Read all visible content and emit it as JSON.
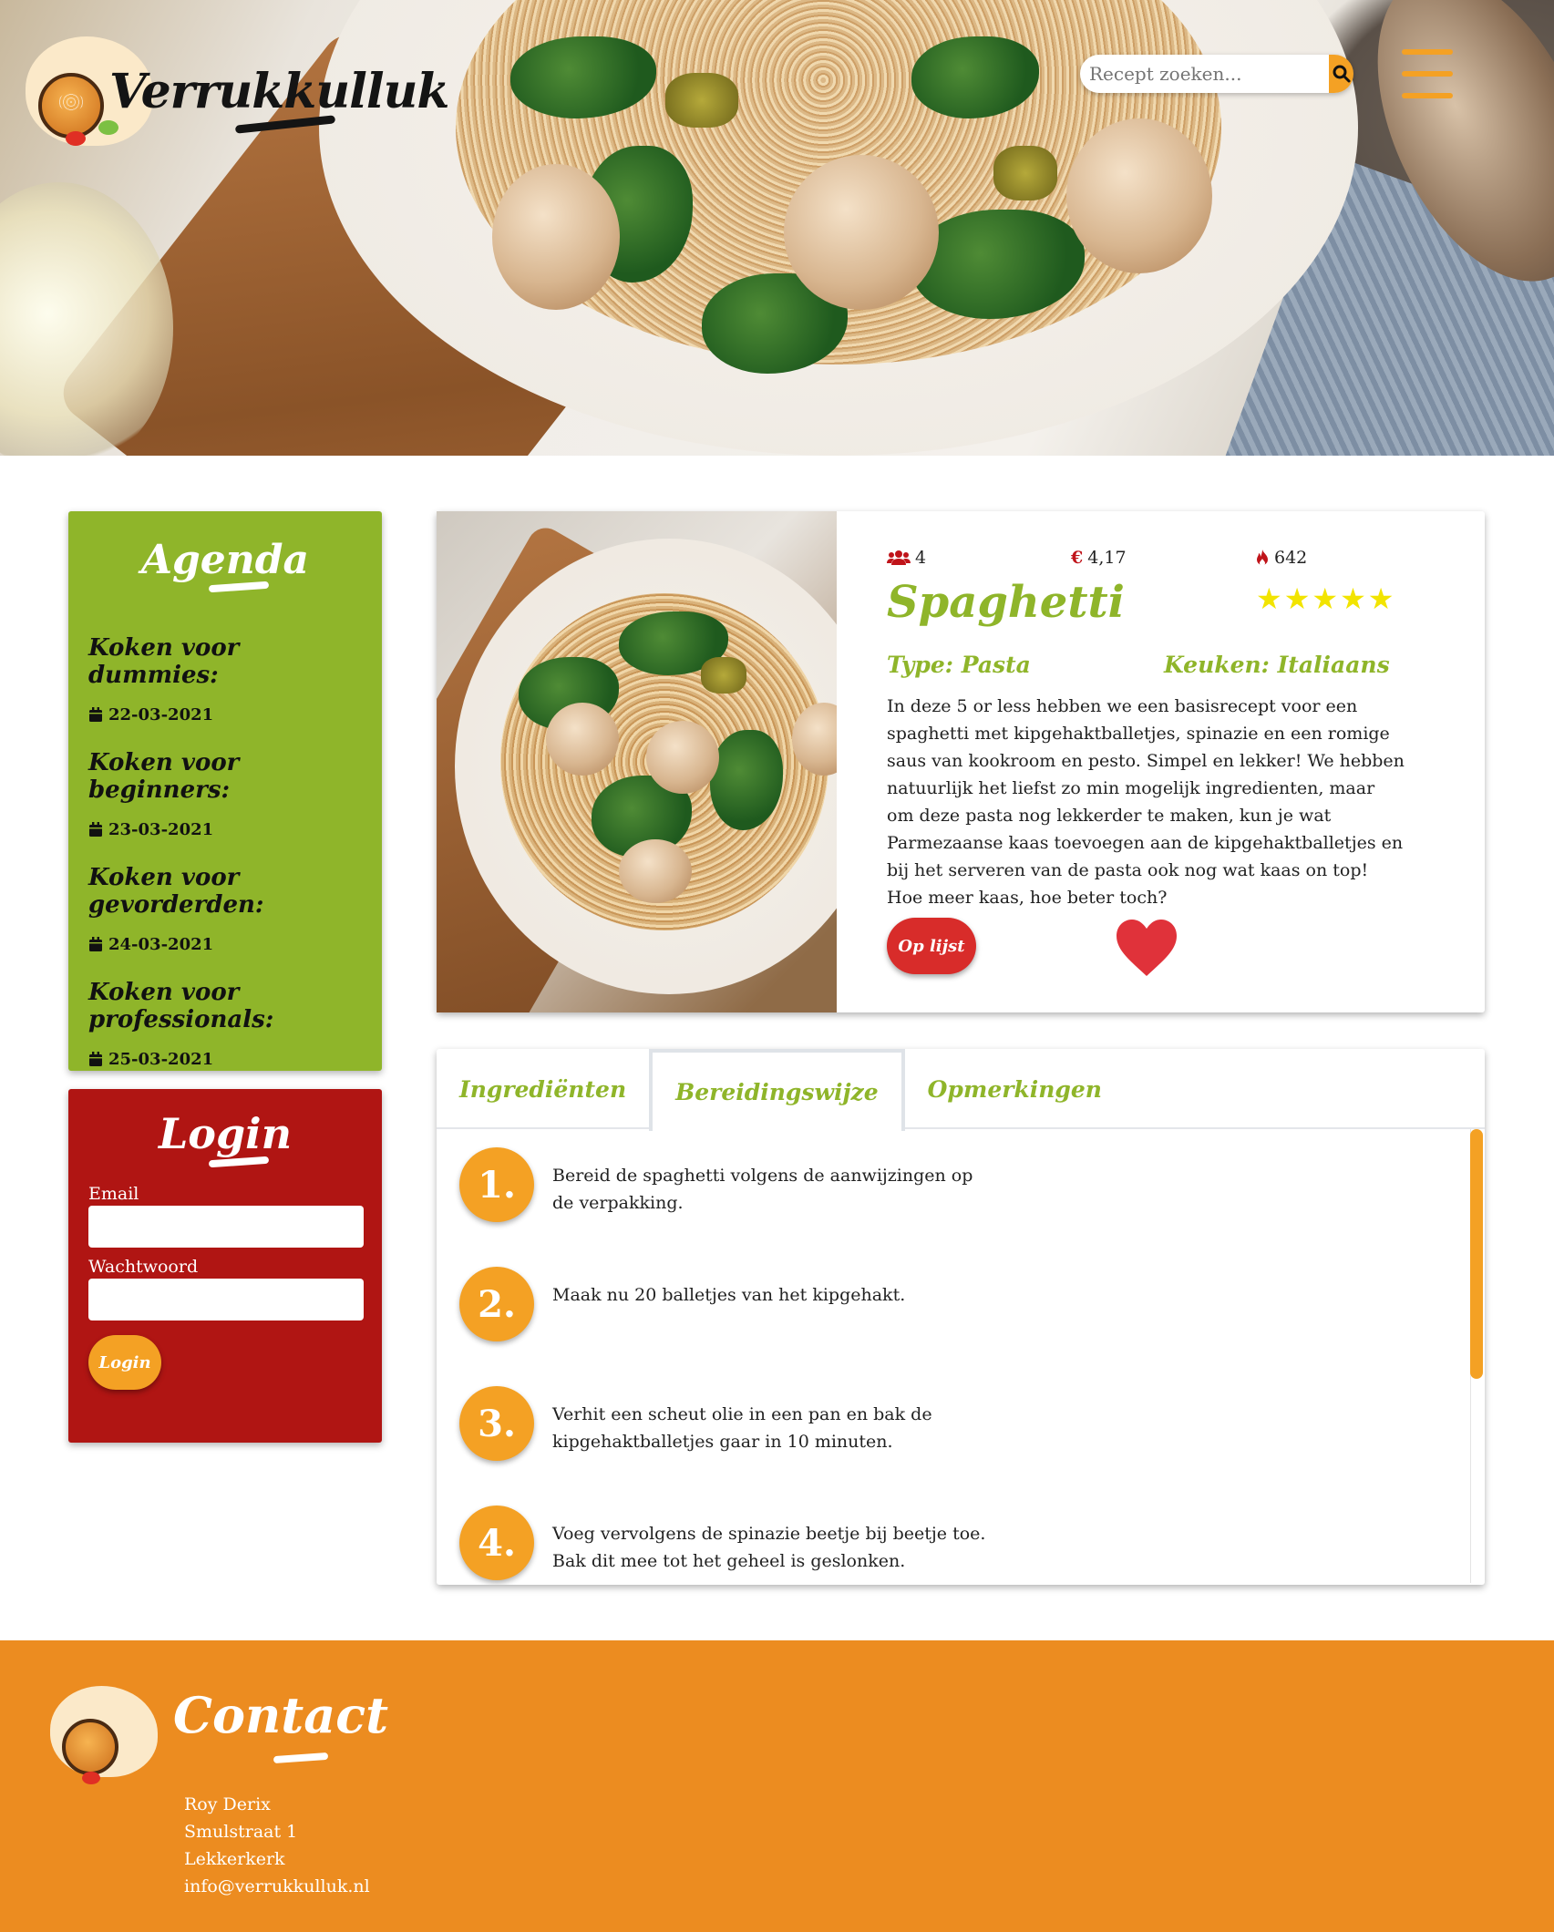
{
  "header": {
    "logo_text": "Verrukkulluk",
    "search_placeholder": "Recept zoeken...",
    "search_icon": "search-icon",
    "menu_icon": "hamburger-menu-icon"
  },
  "colors": {
    "green": "#8fb52a",
    "red": "#b01513",
    "orange": "#f4a124",
    "footer_orange": "#ec8c20",
    "star_yellow": "#f2e400"
  },
  "agenda": {
    "title": "Agenda",
    "items": [
      {
        "title": "Koken voor dummies:",
        "date": "22-03-2021"
      },
      {
        "title": "Koken voor beginners:",
        "date": "23-03-2021"
      },
      {
        "title": "Koken voor gevorderden:",
        "date": "24-03-2021"
      },
      {
        "title": "Koken voor professionals:",
        "date": "25-03-2021"
      }
    ]
  },
  "login": {
    "title": "Login",
    "email_label": "Email",
    "password_label": "Wachtwoord",
    "button_label": "Login"
  },
  "recipe": {
    "persons": "4",
    "price": "4,17",
    "calories": "642",
    "rating": 5,
    "title": "Spaghetti",
    "type": "Type: Pasta",
    "kitchen": "Keuken: Italiaans",
    "description": "In deze 5 or less hebben we een basisrecept voor een spaghetti met kipgehaktballetjes, spinazie en een romige saus van kookroom en pesto. Simpel en lekker! We hebben natuurlijk het liefst zo min mogelijk ingredienten, maar om deze pasta nog lekkerder te maken, kun je wat Parmezaanse kaas toevoegen aan de kipgehaktballetjes en bij het serveren van de pasta ook nog wat kaas on top! Hoe meer kaas, hoe beter toch?",
    "list_button": "Op lijst",
    "favorite_icon": "heart-icon"
  },
  "tabs": {
    "items": [
      "Ingrediënten",
      "Bereidingswijze",
      "Opmerkingen"
    ],
    "active": "Bereidingswijze"
  },
  "steps": [
    {
      "num": "1.",
      "text": "Bereid de spaghetti volgens de aanwijzingen op de verpakking."
    },
    {
      "num": "2.",
      "text": "Maak nu 20 balletjes van het kipgehakt."
    },
    {
      "num": "3.",
      "text": "Verhit een scheut olie in een pan en bak de kipgehaktballetjes gaar in 10 minuten."
    },
    {
      "num": "4.",
      "text": "Voeg vervolgens de spinazie beetje bij beetje toe. Bak dit mee tot het geheel is geslonken."
    }
  ],
  "footer": {
    "title": "Contact",
    "name": "Roy Derix",
    "street": "Smulstraat 1",
    "city": "Lekkerkerk",
    "email": "info@verrukkulluk.nl"
  }
}
